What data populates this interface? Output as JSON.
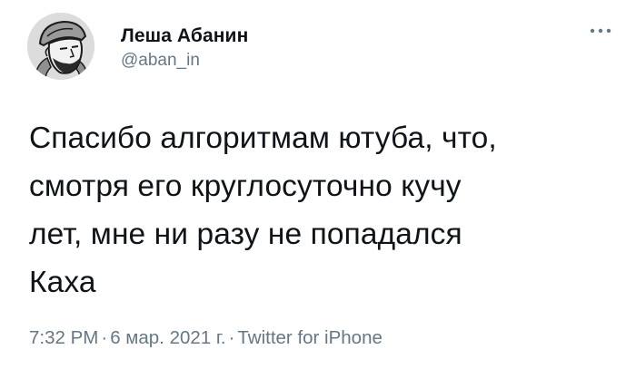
{
  "author": {
    "display_name": "Леша Абанин",
    "handle": "@aban_in"
  },
  "tweet": {
    "text": "Спасибо алгоритмам ютуба, что,\nсмотря его круглосуточно кучу\nлет, мне ни разу не попадался\nКаха"
  },
  "meta": {
    "time": "7:32 PM",
    "separator": "·",
    "date": "6 мар. 2021 г.",
    "source": "Twitter for iPhone"
  },
  "icons": {
    "more": "more-horizontal-icon",
    "avatar": "avatar-sketch"
  },
  "colors": {
    "text": "#0f1419",
    "secondary": "#657786"
  }
}
